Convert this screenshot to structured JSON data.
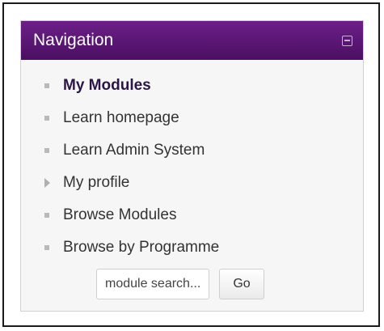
{
  "navigation": {
    "title": "Navigation",
    "collapse_icon": "collapse-icon",
    "items": [
      {
        "label": "My Modules",
        "bold": true,
        "icon": "bullet-icon"
      },
      {
        "label": "Learn homepage",
        "bold": false,
        "icon": "bullet-icon"
      },
      {
        "label": "Learn Admin System",
        "bold": false,
        "icon": "bullet-icon"
      },
      {
        "label": "My profile",
        "bold": false,
        "icon": "expand-triangle-icon"
      },
      {
        "label": "Browse Modules",
        "bold": false,
        "icon": "bullet-icon"
      },
      {
        "label": "Browse by Programme",
        "bold": false,
        "icon": "bullet-icon"
      }
    ]
  },
  "search": {
    "placeholder": "module search...",
    "button_label": "Go"
  },
  "colors": {
    "header": "#5b1677",
    "header_text": "#ffffff",
    "active_link": "#2b1747"
  }
}
